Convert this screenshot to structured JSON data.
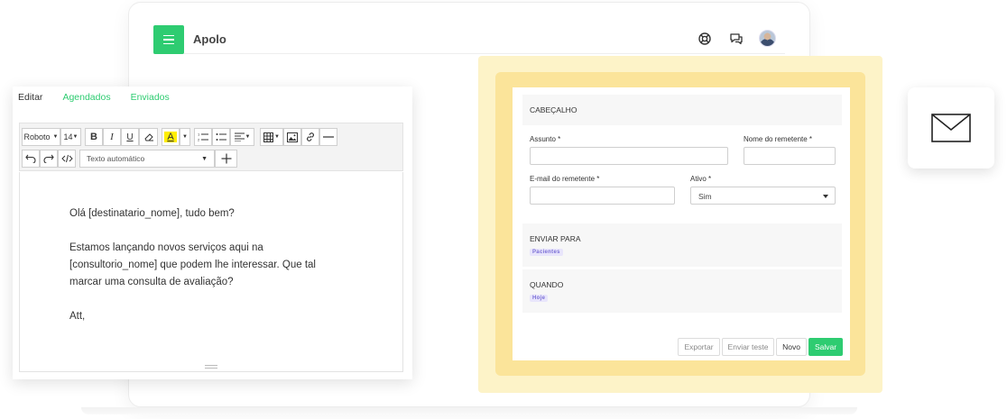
{
  "app": {
    "title": "Apolo"
  },
  "header": {
    "icons": [
      "lifebuoy-icon",
      "chat-icon",
      "avatar"
    ]
  },
  "editor": {
    "tabs": [
      {
        "label": "Editar"
      },
      {
        "label": "Agendados"
      },
      {
        "label": "Enviados"
      }
    ],
    "toolbar": {
      "font_family": "Roboto",
      "font_size": "14",
      "bold": "B",
      "italic": "I",
      "underline": "U",
      "text_color": "A",
      "format_select": "Texto automático"
    },
    "paragraphs": [
      "Olá [destinatario_nome], tudo bem?",
      "Estamos lançando novos serviços aqui na [consultorio_nome] que podem lhe interessar. Que tal marcar uma consulta de avaliação?",
      "Att,"
    ]
  },
  "form": {
    "header_section": "CABEÇALHO",
    "subject_label": "Assunto *",
    "sender_name_label": "Nome do remetente *",
    "sender_email_label": "E-mail do remetente *",
    "active_label": "Ativo *",
    "active_value": "Sim",
    "send_to_section": "ENVIAR PARA",
    "send_to_tag": "Pacientes",
    "when_section": "QUANDO",
    "when_tag": "Hoje",
    "buttons": {
      "export": "Exportar",
      "send_test": "Enviar teste",
      "new": "Novo",
      "save": "Salvar"
    }
  },
  "colors": {
    "accent": "#2ecc71",
    "highlight": "#fbe49a",
    "tag": "#7b6fd6"
  }
}
